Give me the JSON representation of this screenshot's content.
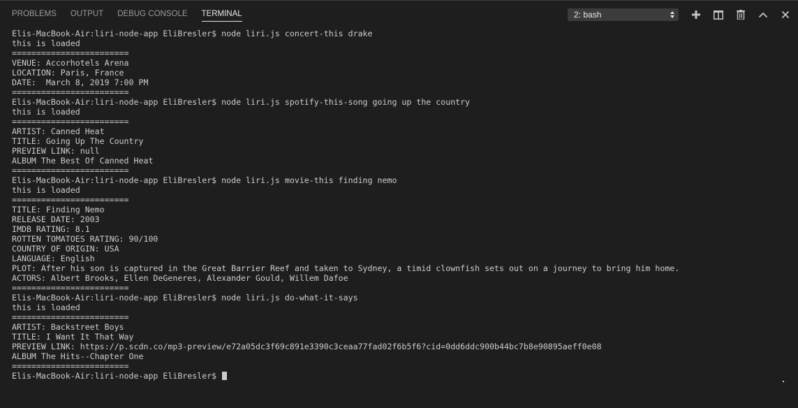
{
  "tabs": [
    {
      "label": "PROBLEMS"
    },
    {
      "label": "OUTPUT"
    },
    {
      "label": "DEBUG CONSOLE"
    },
    {
      "label": "TERMINAL"
    }
  ],
  "terminal_selector": {
    "value": "2: bash"
  },
  "toolbar": {
    "new_terminal_icon": "plus-icon",
    "split_icon": "split-icon",
    "kill_icon": "trash-icon",
    "maximize_icon": "chevron-up-icon",
    "close_icon": "close-icon"
  },
  "terminal": {
    "lines": [
      "Elis-MacBook-Air:liri-node-app EliBresler$ node liri.js concert-this drake",
      "this is loaded",
      "========================",
      "VENUE: Accorhotels Arena",
      "LOCATION: Paris, France",
      "DATE:  March 8, 2019 7:00 PM",
      "========================",
      "Elis-MacBook-Air:liri-node-app EliBresler$ node liri.js spotify-this-song going up the country",
      "this is loaded",
      "========================",
      "ARTIST: Canned Heat",
      "TITLE: Going Up The Country",
      "PREVIEW LINK: null",
      "ALBUM The Best Of Canned Heat",
      "========================",
      "Elis-MacBook-Air:liri-node-app EliBresler$ node liri.js movie-this finding nemo",
      "this is loaded",
      "========================",
      "TITLE: Finding Nemo",
      "RELEASE DATE: 2003",
      "IMDB RATING: 8.1",
      "ROTTEN TOMATOES RATING: 90/100",
      "COUNTRY OF ORIGIN: USA",
      "LANGUAGE: English",
      "PLOT: After his son is captured in the Great Barrier Reef and taken to Sydney, a timid clownfish sets out on a journey to bring him home.",
      "ACTORS: Albert Brooks, Ellen DeGeneres, Alexander Gould, Willem Dafoe",
      "========================",
      "Elis-MacBook-Air:liri-node-app EliBresler$ node liri.js do-what-it-says",
      "this is loaded",
      "========================",
      "ARTIST: Backstreet Boys",
      "TITLE: I Want It That Way",
      "PREVIEW LINK: https://p.scdn.co/mp3-preview/e72a05dc3f69c891e3390c3ceaa77fad02f6b5f6?cid=0dd6ddc900b44bc7b8e90895aeff0e08",
      "ALBUM The Hits--Chapter One",
      "========================"
    ],
    "prompt": "Elis-MacBook-Air:liri-node-app EliBresler$ "
  },
  "colors": {
    "background": "#1e1e1e",
    "text": "#cccccc",
    "tab_active": "#e7e7e7",
    "tab_inactive": "#9b9b9b",
    "select_bg": "#3c3c3c"
  }
}
